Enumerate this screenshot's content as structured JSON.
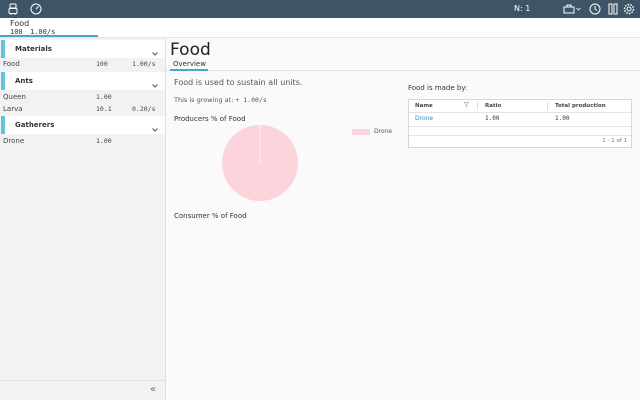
{
  "topbar": {
    "counter": "N: 1",
    "icons": [
      "robot-app-icon",
      "speedometer-icon",
      "toolbox-icon",
      "chevron-down-icon",
      "history-icon",
      "pause-icon",
      "gear-icon"
    ]
  },
  "resource_strip": {
    "name": "Food",
    "quantity": "100",
    "rate": "1.00/s"
  },
  "sidebar": {
    "groups": [
      {
        "title": "Materials",
        "rows": [
          {
            "name": "Food",
            "qty": "100",
            "rate": "1.00/s"
          }
        ]
      },
      {
        "title": "Ants",
        "rows": [
          {
            "name": "Queen",
            "qty": "1.00",
            "rate": ""
          },
          {
            "name": "Larva",
            "qty": "10.1",
            "rate": "0.20/s"
          }
        ]
      },
      {
        "title": "Gatherers",
        "rows": [
          {
            "name": "Drone",
            "qty": "1.00",
            "rate": ""
          }
        ]
      }
    ],
    "collapse_glyph": "«"
  },
  "main": {
    "title": "Food",
    "tab": "Overview",
    "description": "Food is used to sustain all units.",
    "growing_label": "This is growing at:",
    "growing_value": "+ 1.00/s",
    "producers_title": "Producers % of Food",
    "consumers_title": "Consumer % of Food",
    "made_by_title": "Food is made by:",
    "table": {
      "headers": [
        "Name",
        "Ratio",
        "Total production"
      ],
      "rows": [
        {
          "name": "Drone",
          "ratio": "1.00",
          "total": "1.00"
        }
      ],
      "pagination": "1 - 1 of 1"
    }
  },
  "chart_data": {
    "type": "pie",
    "title": "Producers % of Food",
    "labels": [
      "Drone"
    ],
    "values": [
      100
    ],
    "colors": [
      "#fbd4dc"
    ],
    "legend": "right"
  },
  "colors": {
    "topbar": "#3d5566",
    "accent": "#5fc4e0",
    "link": "#2a90c4",
    "slice": "#fbd4dc"
  }
}
